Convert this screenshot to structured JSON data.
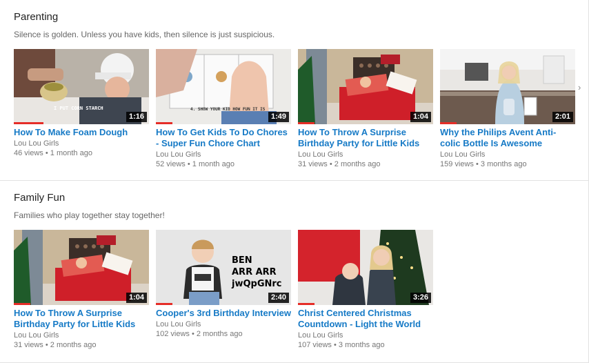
{
  "shelves": [
    {
      "title": "Parenting",
      "description": "Silence is golden. Unless you have kids, then silence is just suspicious.",
      "videos": [
        {
          "title": "How To Make Foam Dough",
          "channel": "Lou Lou Girls",
          "views": "46 views",
          "age": "1 month ago",
          "duration": "1:16",
          "watched": 0.22,
          "thumb_text": "I PUT CORN STARCH"
        },
        {
          "title": "How To Get Kids To Do Chores - Super Fun Chore Chart",
          "channel": "Lou Lou Girls",
          "views": "52 views",
          "age": "1 month ago",
          "duration": "1:49",
          "watched": 0.12,
          "thumb_text": "4. SHOW YOUR KID HOW FUN IT IS"
        },
        {
          "title": "How To Throw A Surprise Birthday Party for Little Kids",
          "channel": "Lou Lou Girls",
          "views": "31 views",
          "age": "2 months ago",
          "duration": "1:04",
          "watched": 0.12
        },
        {
          "title": "Why the Philips Avent Anti-colic Bottle Is Awesome",
          "channel": "Lou Lou Girls",
          "views": "159 views",
          "age": "3 months ago",
          "duration": "2:01",
          "watched": 0.12
        }
      ]
    },
    {
      "title": "Family Fun",
      "description": "Families who play together stay together!",
      "videos": [
        {
          "title": "How To Throw A Surprise Birthday Party for Little Kids",
          "channel": "Lou Lou Girls",
          "views": "31 views",
          "age": "2 months ago",
          "duration": "1:04",
          "watched": 0.12
        },
        {
          "title": "Cooper's 3rd Birthday Interview",
          "channel": "Lou Lou Girls",
          "views": "102 views",
          "age": "2 months ago",
          "duration": "2:40",
          "watched": 0.12,
          "thumb_lines": [
            "BEN",
            "ARR ARR",
            "jwQpGNrc"
          ]
        },
        {
          "title": "Christ Centered Christmas Countdown - Light the World",
          "channel": "Lou Lou Girls",
          "views": "107 views",
          "age": "3 months ago",
          "duration": "3:26",
          "watched": 0.12
        }
      ]
    }
  ],
  "meta_separator": "•",
  "next_icon": "›",
  "colors": {
    "link": "#167ac6",
    "progress": "#e52d27",
    "muted": "#767676"
  }
}
